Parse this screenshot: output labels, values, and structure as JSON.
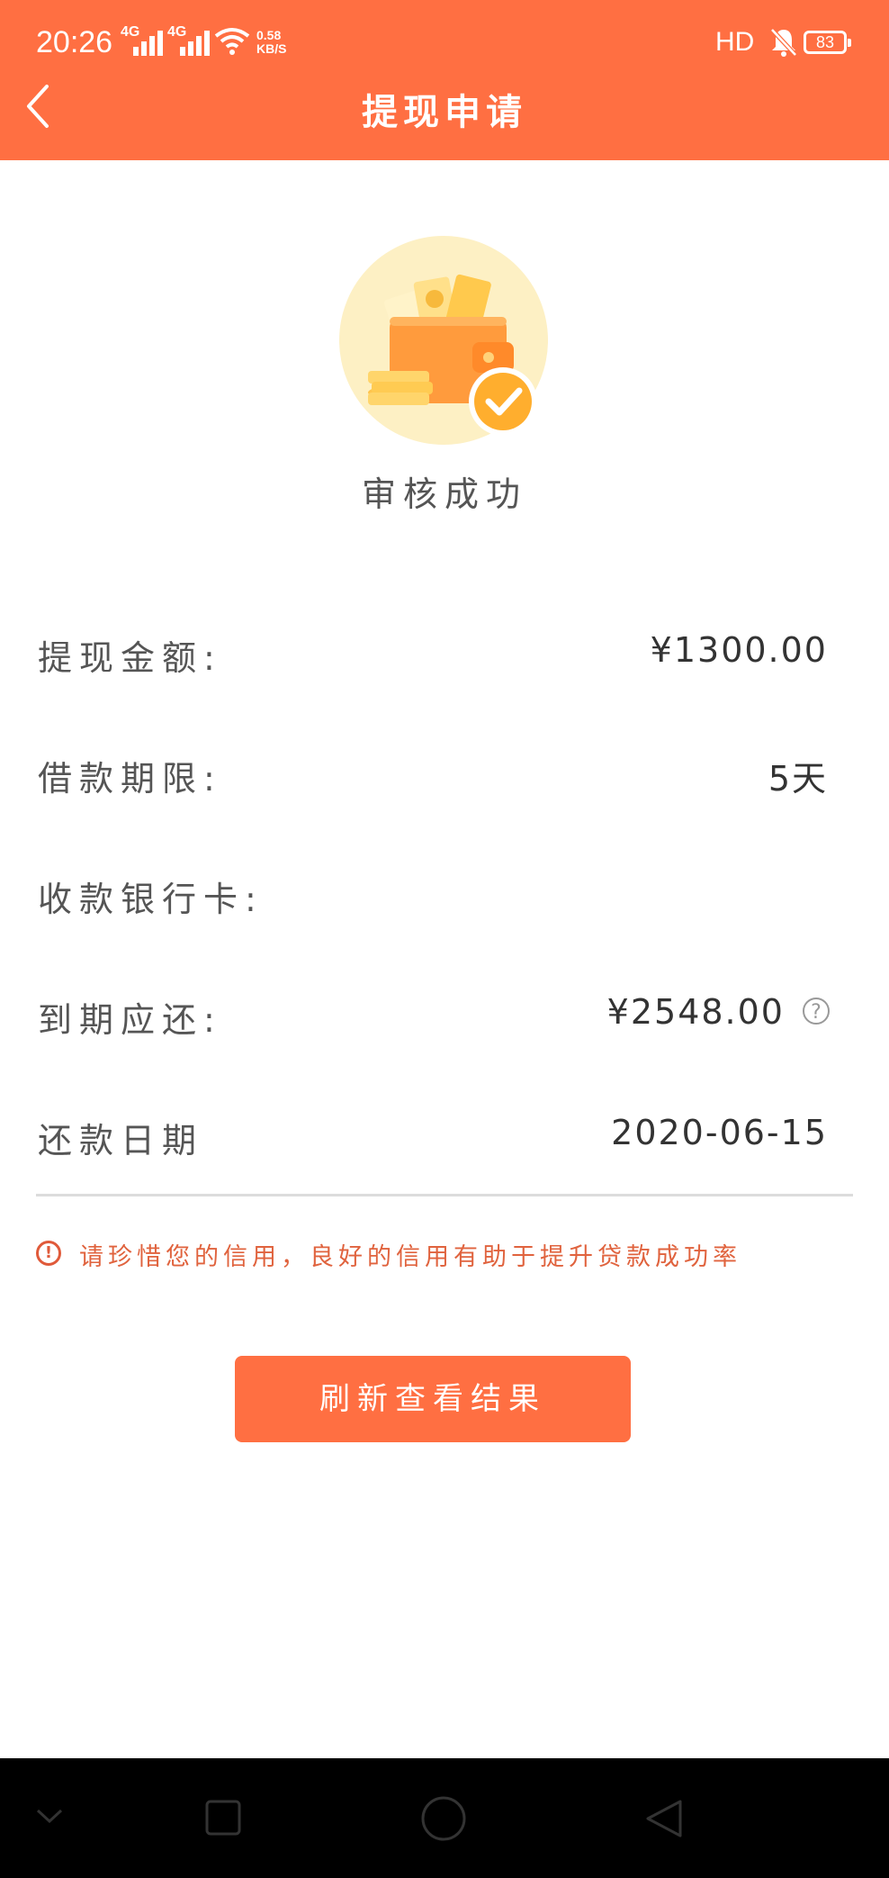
{
  "status_bar": {
    "time": "20:26",
    "network1": "4G",
    "network2": "4G",
    "speed_value": "0.58",
    "speed_unit": "KB/S",
    "hd": "HD",
    "battery": "83"
  },
  "header": {
    "title": "提现申请"
  },
  "result": {
    "status": "审核成功"
  },
  "details": [
    {
      "label": "提现金额:",
      "value": "¥1300.00"
    },
    {
      "label": "借款期限:",
      "value": "5天"
    },
    {
      "label": "收款银行卡:",
      "value": ""
    },
    {
      "label": "到期应还:",
      "value": "¥2548.00"
    },
    {
      "label": "还款日期",
      "value": "2020-06-15"
    }
  ],
  "warning": {
    "text": "请珍惜您的信用，良好的信用有助于提升贷款成功率"
  },
  "actions": {
    "refresh_label": "刷新查看结果"
  },
  "colors": {
    "accent": "#ff6f42",
    "warning": "#e0633e"
  }
}
